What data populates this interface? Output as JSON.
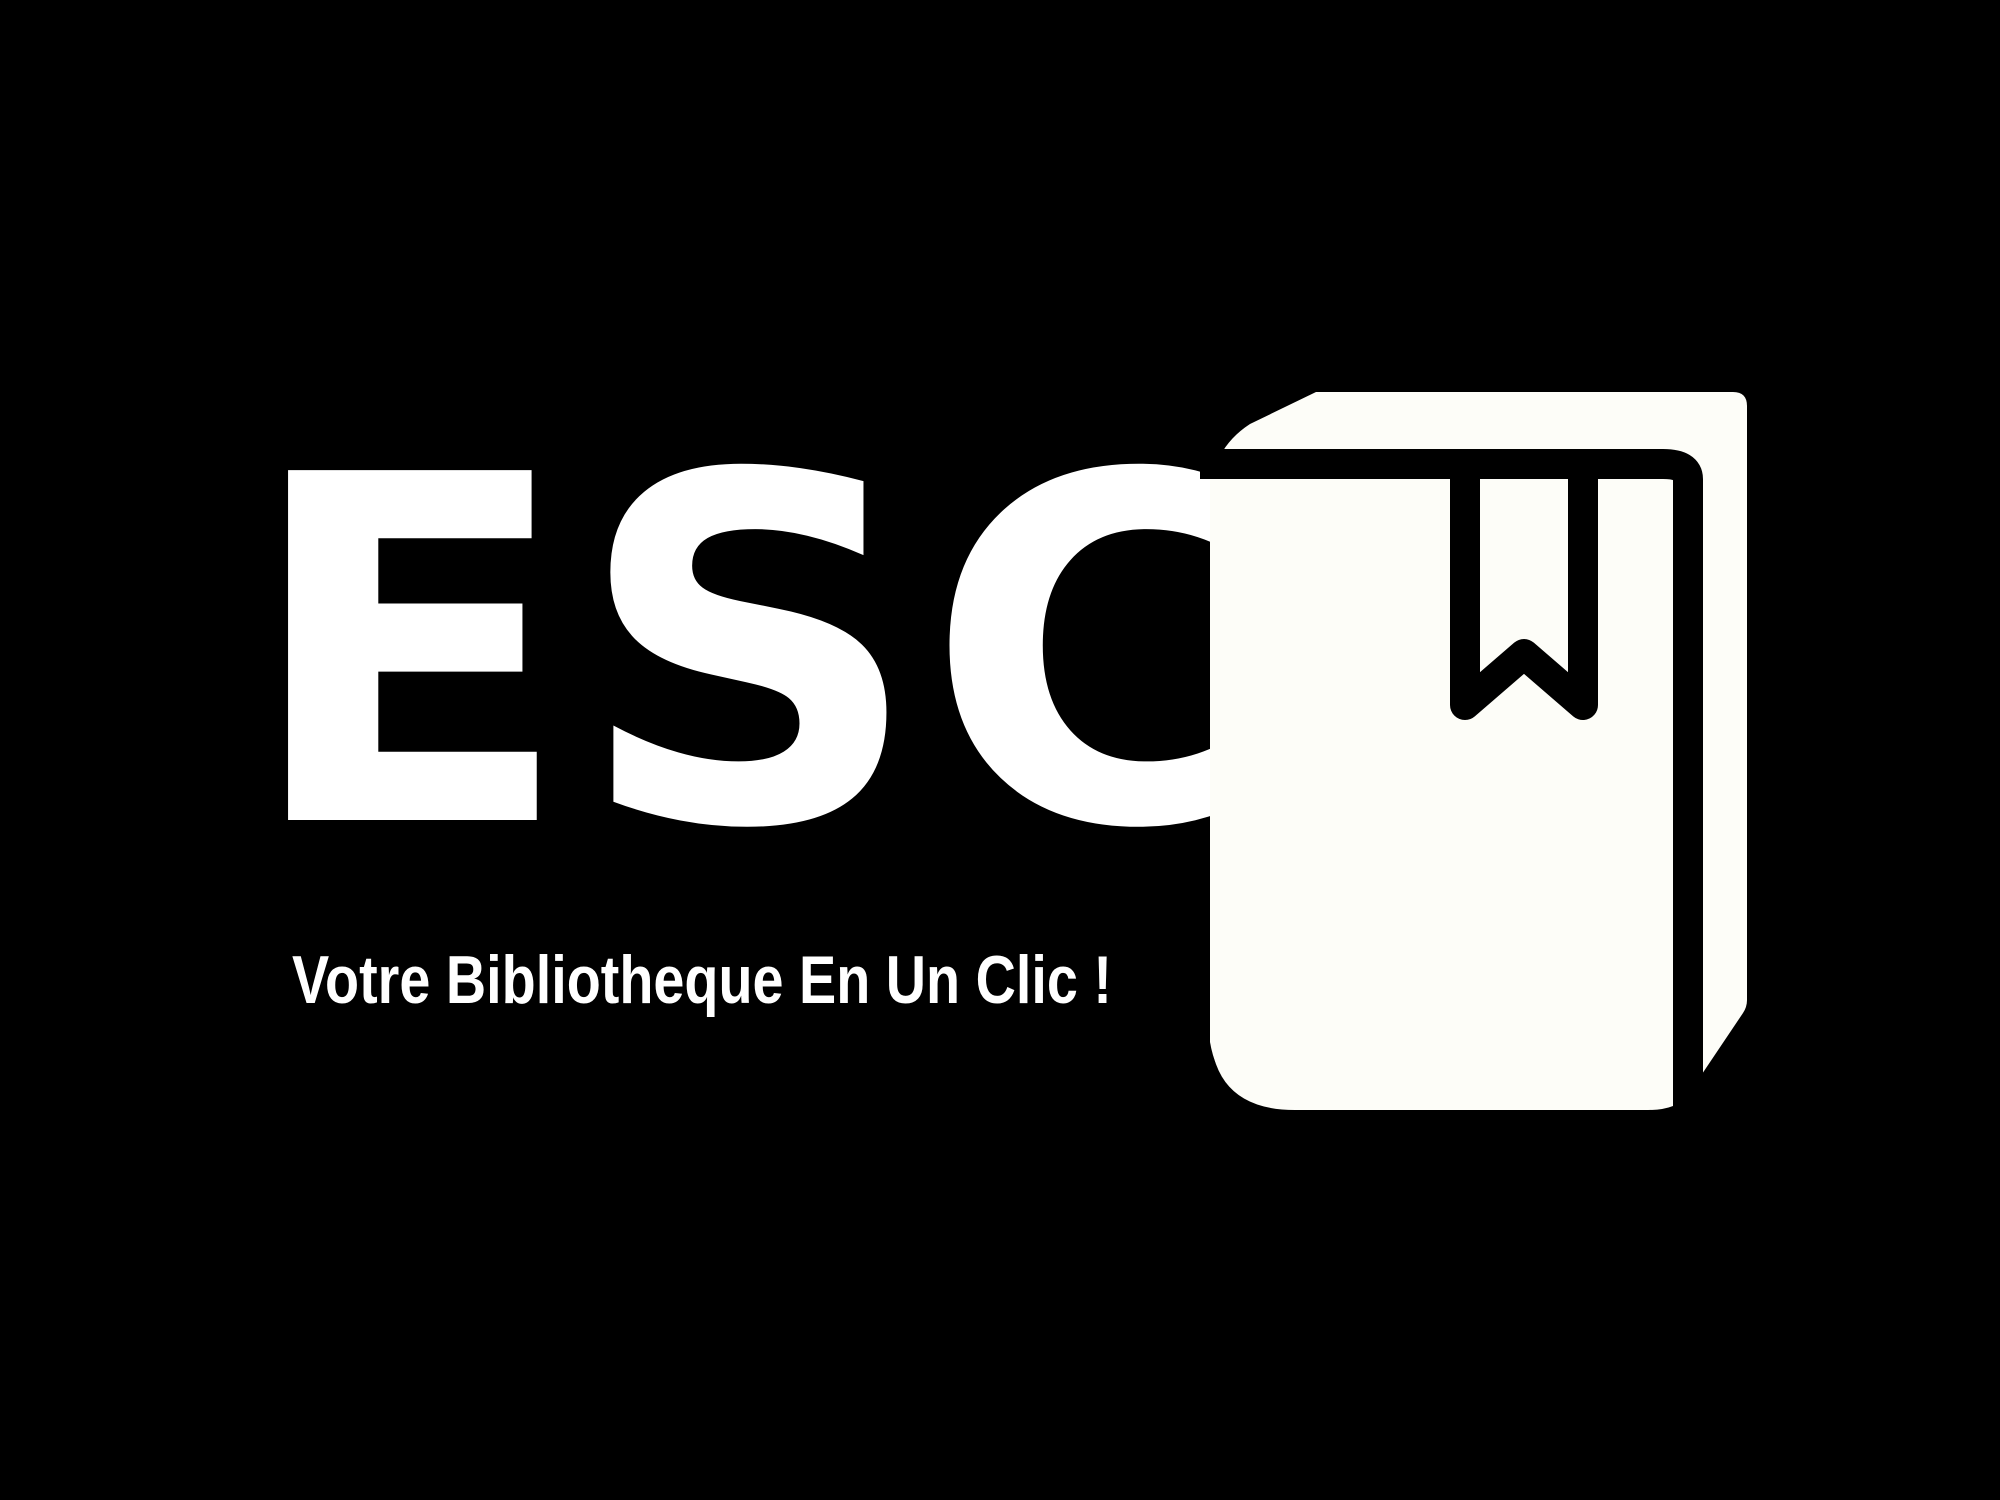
{
  "logo": {
    "wordmark": "ESC",
    "tagline": "Votre Bibliotheque En Un Clic !",
    "icon": "book-with-bookmark-icon"
  },
  "colors": {
    "background": "#000000",
    "text": "#ffffff",
    "book_fill": "#fdfdf8",
    "book_outline": "#000000"
  }
}
